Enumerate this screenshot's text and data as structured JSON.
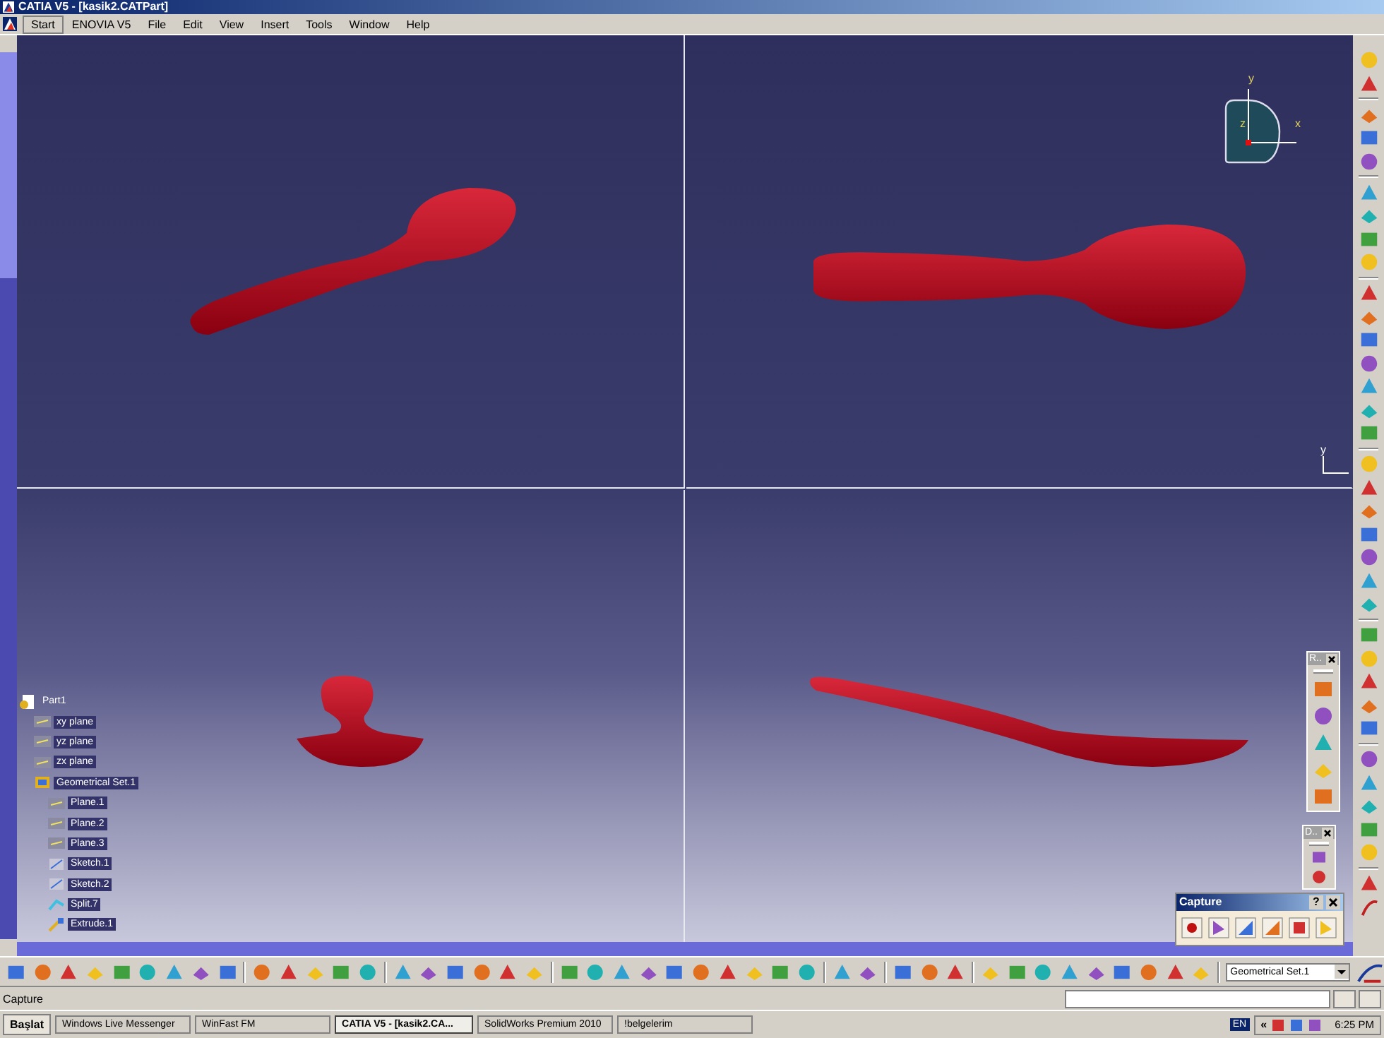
{
  "window": {
    "title": "CATIA V5 - [kasik2.CATPart]"
  },
  "menu": [
    {
      "label": "Start",
      "selected": true
    },
    {
      "label": "ENOVIA V5",
      "selected": false
    },
    {
      "label": "File",
      "selected": false
    },
    {
      "label": "Edit",
      "selected": false
    },
    {
      "label": "View",
      "selected": false
    },
    {
      "label": "Insert",
      "selected": false
    },
    {
      "label": "Tools",
      "selected": false
    },
    {
      "label": "Window",
      "selected": false
    },
    {
      "label": "Help",
      "selected": false
    }
  ],
  "compass": {
    "x_label": "x",
    "y_label": "y",
    "z_label": "z"
  },
  "axis_label": "y",
  "tree": [
    {
      "label": "Part1",
      "kind": "part",
      "children": [
        {
          "label": "xy plane",
          "kind": "plane"
        },
        {
          "label": "yz plane",
          "kind": "plane"
        },
        {
          "label": "zx plane",
          "kind": "plane"
        },
        {
          "label": "Geometrical Set.1",
          "kind": "set",
          "children": [
            {
              "label": "Plane.1",
              "kind": "plane"
            },
            {
              "label": "Plane.2",
              "kind": "plane"
            },
            {
              "label": "Plane.3",
              "kind": "plane"
            },
            {
              "label": "Sketch.1",
              "kind": "sketch"
            },
            {
              "label": "Sketch.2",
              "kind": "sketch"
            },
            {
              "label": "Split.7",
              "kind": "split"
            },
            {
              "label": "Extrude.1",
              "kind": "extrude"
            }
          ]
        }
      ]
    }
  ],
  "floating_toolbars": [
    {
      "title": "R.."
    },
    {
      "title": "D.."
    }
  ],
  "capture_panel": {
    "title": "Capture",
    "help": "?"
  },
  "combo": {
    "value": "Geometrical Set.1"
  },
  "status_bar": {
    "text": "Capture"
  },
  "taskbar": {
    "start": "Başlat",
    "items": [
      {
        "label": "Windows Live Messenger",
        "selected": false
      },
      {
        "label": "WinFast FM",
        "selected": false
      },
      {
        "label": "CATIA V5 - [kasik2.CA...",
        "selected": true
      },
      {
        "label": "SolidWorks Premium 2010",
        "selected": false
      },
      {
        "label": "!belgelerim",
        "selected": false
      }
    ],
    "language": "EN",
    "tray_toggle": "«",
    "clock": "6:25 PM"
  }
}
